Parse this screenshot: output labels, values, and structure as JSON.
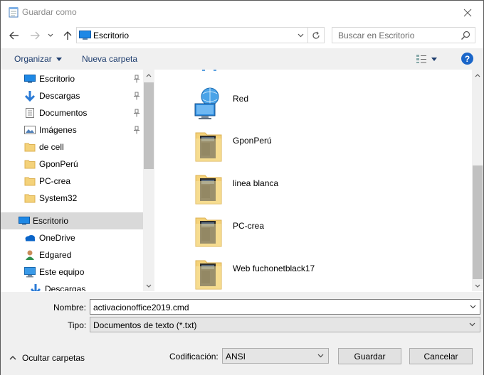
{
  "window": {
    "title": "Guardar como"
  },
  "navigation": {
    "location": "Escritorio",
    "search_placeholder": "Buscar en Escritorio"
  },
  "toolbar": {
    "organize_label": "Organizar",
    "new_folder_label": "Nueva carpeta",
    "help_label": "?"
  },
  "sidebar": {
    "items": [
      {
        "label": "Escritorio",
        "icon": "desktop-icon",
        "pinned": true
      },
      {
        "label": "Descargas",
        "icon": "download-icon",
        "pinned": true
      },
      {
        "label": "Documentos",
        "icon": "documents-icon",
        "pinned": true
      },
      {
        "label": "Imágenes",
        "icon": "pictures-icon",
        "pinned": true
      },
      {
        "label": "de cell",
        "icon": "folder-icon",
        "pinned": false
      },
      {
        "label": "GponPerú",
        "icon": "folder-icon",
        "pinned": false
      },
      {
        "label": "PC-crea",
        "icon": "folder-icon",
        "pinned": false
      },
      {
        "label": "System32",
        "icon": "folder-icon",
        "pinned": false
      },
      {
        "label": "Escritorio",
        "icon": "desktop-icon",
        "pinned": false,
        "selected": true
      },
      {
        "label": "OneDrive",
        "icon": "onedrive-icon",
        "pinned": false
      },
      {
        "label": "Edgared",
        "icon": "user-icon",
        "pinned": false
      },
      {
        "label": "Este equipo",
        "icon": "computer-icon",
        "pinned": false
      },
      {
        "label": "Descargas",
        "icon": "download-icon",
        "pinned": false
      }
    ]
  },
  "files": [
    {
      "name": "Red",
      "icon": "network-icon"
    },
    {
      "name": "GponPerú",
      "icon": "folder-icon"
    },
    {
      "name": "linea blanca",
      "icon": "folder-icon"
    },
    {
      "name": "PC-crea",
      "icon": "folder-icon"
    },
    {
      "name": "Web fuchonetblack17",
      "icon": "folder-icon"
    }
  ],
  "form": {
    "filename_label": "Nombre:",
    "filename_value": "activacionoffice2019.cmd",
    "type_label": "Tipo:",
    "type_value": "Documentos de texto (*.txt)",
    "encoding_label": "Codificación:",
    "encoding_value": "ANSI",
    "save_label": "Guardar",
    "cancel_label": "Cancelar",
    "hide_folders_label": "Ocultar carpetas"
  },
  "colors": {
    "accent": "#1a66c9",
    "selection": "#d9d9d9",
    "toolbar_bg": "#f0f0f0",
    "folder": "#f4d27a"
  }
}
